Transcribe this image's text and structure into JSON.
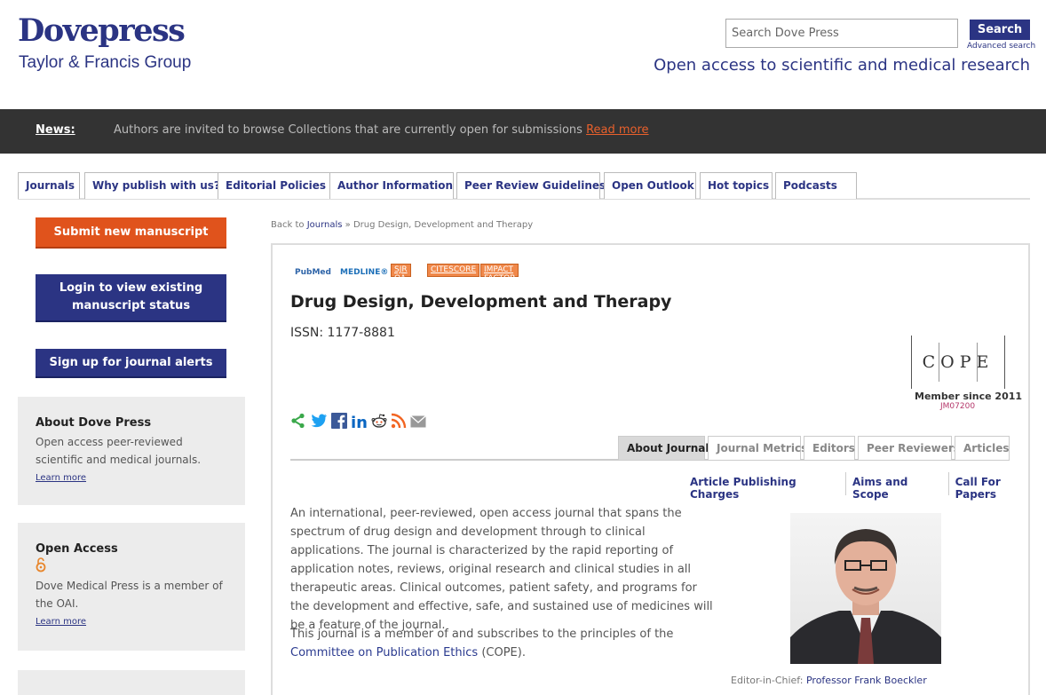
{
  "header": {
    "logo_main": "Dovepress",
    "logo_sub": "Taylor & Francis Group",
    "search_placeholder": "Search Dove Press",
    "search_button": "Search",
    "advanced_search": "Advanced search",
    "tagline": "Open access to scientific and medical research"
  },
  "news": {
    "label": "News:",
    "text": "Authors are invited to browse Collections that are currently open for submissions ",
    "link": "Read more"
  },
  "nav": {
    "tabs": [
      "Journals",
      "Why publish with us?",
      "Editorial Policies",
      "Author Information",
      "Peer Review Guidelines",
      "Open Outlook",
      "Hot topics",
      "Podcasts"
    ]
  },
  "sidebar": {
    "submit_button": "Submit new manuscript",
    "login_button": "Login to view existing manuscript status",
    "alerts_button": "Sign up for journal alerts",
    "about": {
      "title": "About Dove Press",
      "text": "Open access peer-reviewed scientific and medical journals.",
      "link": "Learn more"
    },
    "open_access": {
      "title": "Open Access",
      "text": "Dove Medical Press is a member of the OAI.",
      "link": "Learn more"
    }
  },
  "breadcrumb": {
    "prefix": "Back to ",
    "link": "Journals",
    "suffix": " » Drug Design, Development and Therapy"
  },
  "journal": {
    "badges": [
      "PubMed",
      "MEDLINE®",
      "SJR OA",
      "CITESCORE",
      "IMPACT FACTOR"
    ],
    "title": "Drug Design, Development and Therapy",
    "issn": "ISSN: 1177-8881",
    "cope": {
      "logo": "COPE",
      "member_since": "Member since 2011",
      "id": "JM07200"
    },
    "tabs": [
      "About Journal",
      "Journal Metrics",
      "Editors",
      "Peer Reviewers",
      "Articles"
    ],
    "active_tab": "About Journal",
    "sub_links": [
      "Article Publishing Charges",
      "Aims and Scope",
      "Call For Papers"
    ],
    "description": "An international, peer-reviewed, open access journal that spans the spectrum of drug design and development through to clinical applications. The journal is characterized by the rapid reporting of application notes, reviews, original research and clinical studies in all therapeutic areas. Clinical outcomes, patient safety, and programs for the development and effective, safe, and sustained use of medicines will be a feature of the journal.",
    "membership_prefix": "This journal is a member of and subscribes to the principles of the ",
    "membership_link": "Committee on Publication Ethics",
    "membership_suffix": " (COPE).",
    "editor_label": "Editor-in-Chief: ",
    "editor_name": "Professor Frank Boeckler"
  },
  "colors": {
    "brand": "#2b3483",
    "accent": "#e0531c",
    "news_bg": "#333333"
  }
}
